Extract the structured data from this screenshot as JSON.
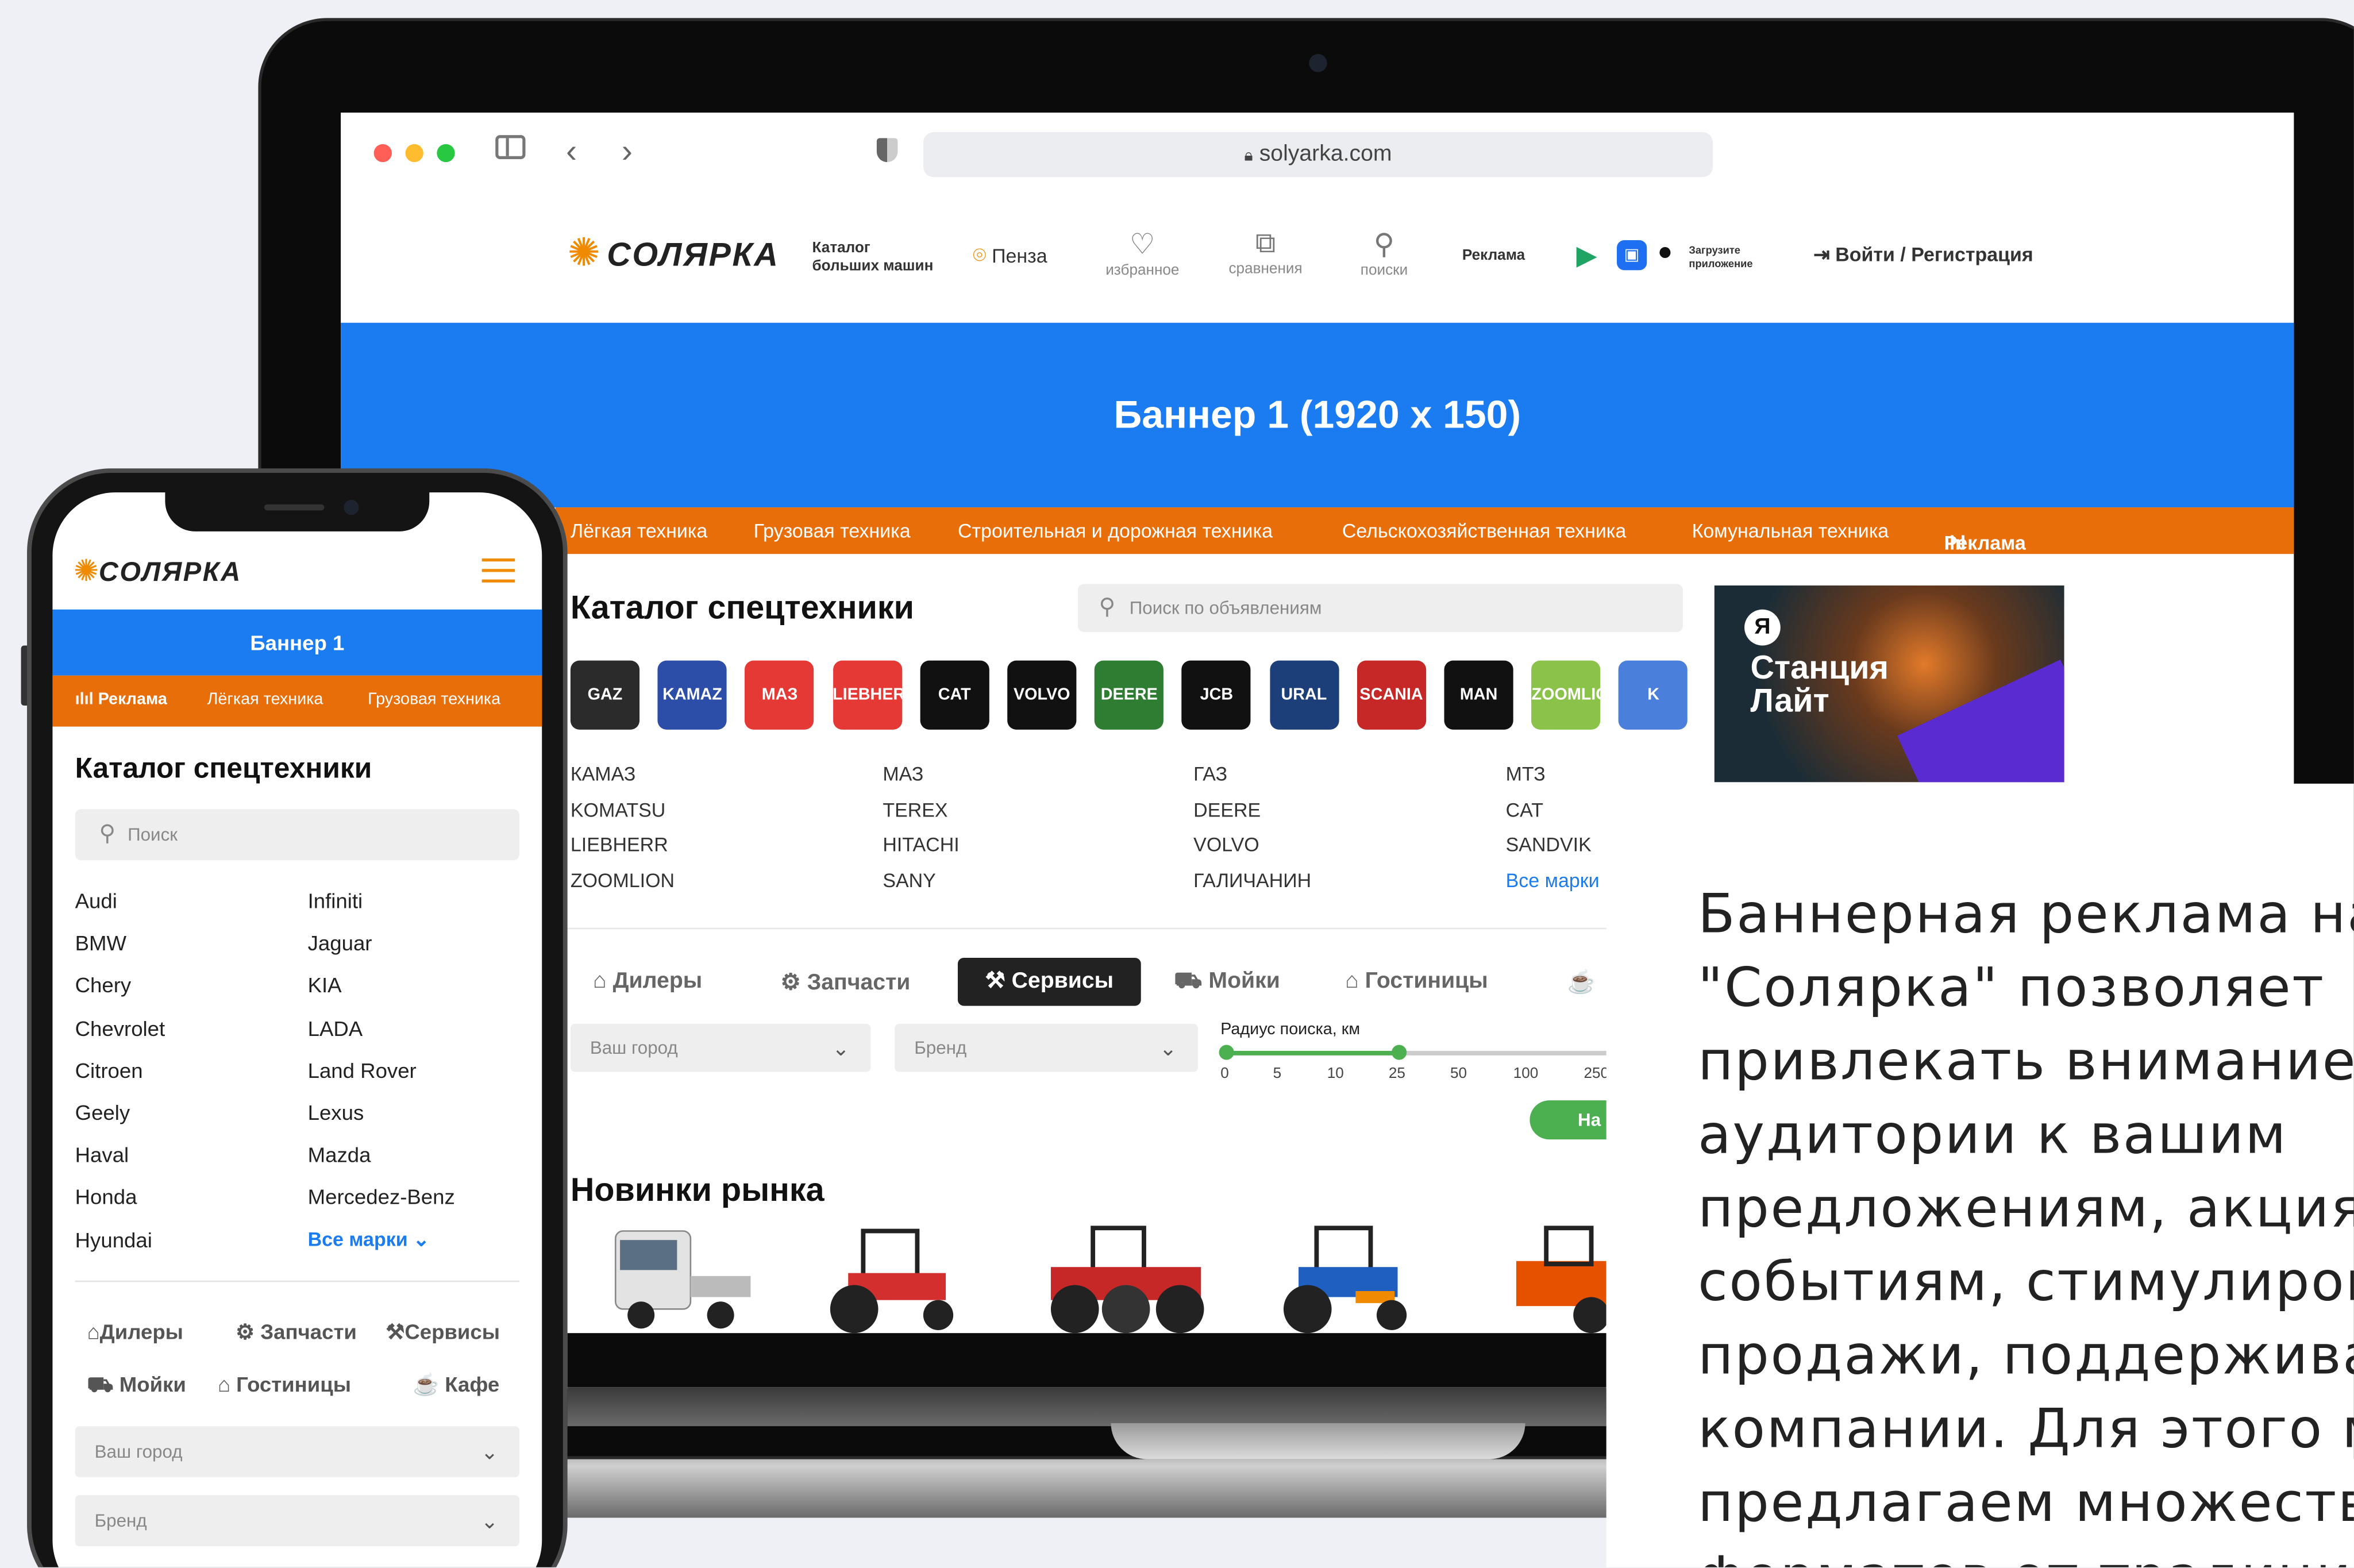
{
  "browser": {
    "url": "solyarka.com"
  },
  "site": {
    "logo": "СОЛЯРКА",
    "tagline_1": "Каталог",
    "tagline_2": "больших машин",
    "city": "Пенза",
    "nav": [
      "избранное",
      "сравнения",
      "поиски"
    ],
    "ads_link": "Реклама",
    "app_1": "Загрузите",
    "app_2": "приложение",
    "login": "Войти / Регистрация"
  },
  "banner": {
    "text": "Баннер 1 (1920 х 150)"
  },
  "categories": [
    "Лёгкая техника",
    "Грузовая техника",
    "Строительная и дорожная техника",
    "Сельскохозяйственная техника",
    "Комунальная техника",
    "Реклама"
  ],
  "catalog": {
    "title": "Каталог спецтехники",
    "search_placeholder": "Поиск по объявлениям",
    "logos": [
      {
        "label": "GAZ",
        "color": "#2b2b2b"
      },
      {
        "label": "KAMAZ",
        "color": "#2d4ea8"
      },
      {
        "label": "МАЗ",
        "color": "#e53935"
      },
      {
        "label": "LIEBHERR",
        "color": "#e53935"
      },
      {
        "label": "CAT",
        "color": "#111111"
      },
      {
        "label": "VOLVO",
        "color": "#111111"
      },
      {
        "label": "DEERE",
        "color": "#2e7d32"
      },
      {
        "label": "JCB",
        "color": "#111111"
      },
      {
        "label": "URAL",
        "color": "#1c3f7a"
      },
      {
        "label": "SCANIA",
        "color": "#c62828"
      },
      {
        "label": "MAN",
        "color": "#111111"
      },
      {
        "label": "ZOOMLION",
        "color": "#8bc34a"
      },
      {
        "label": "K",
        "color": "#4a7fdc"
      }
    ],
    "brands": [
      [
        "КАМАЗ",
        "KOMATSU",
        "LIEBHERR",
        "ZOOMLION"
      ],
      [
        "МАЗ",
        "TEREX",
        "HITACHI",
        "SANY"
      ],
      [
        "ГАЗ",
        "DEERE",
        "VOLVO",
        "ГАЛИЧАНИН"
      ],
      [
        "МТЗ",
        "CAT",
        "SANDVIK",
        "Все марки"
      ]
    ]
  },
  "tabs": [
    "Дилеры",
    "Запчасти",
    "Сервисы",
    "Мойки",
    "Гостиницы"
  ],
  "filters": {
    "city": "Ваш город",
    "brand": "Бренд",
    "radius_label": "Радиус поиска, км",
    "ticks": [
      "0",
      "5",
      "10",
      "25",
      "50",
      "100",
      "250"
    ],
    "button": "На"
  },
  "ad": {
    "line1": "Станция",
    "line2": "Лайт",
    "mark": "Я"
  },
  "news": {
    "title": "Новинки рынка"
  },
  "description": {
    "lines": [
      "Баннерная реклама на п",
      "\"Солярка\" позволяет",
      "привлекать внимание це",
      "аудитории к вашим",
      "предложениям, акциям,",
      "событиям, стимулирова",
      "продажи, поддерживать",
      "компании. Для этого мы",
      "предлагаем множество",
      "форматов от традицион"
    ]
  },
  "mobile": {
    "logo": "СОЛЯРКА",
    "banner": "Баннер 1",
    "nav": [
      "Реклама",
      "Лёгкая техника",
      "Грузовая техника"
    ],
    "title": "Каталог спецтехники",
    "search": "Поиск",
    "brands_left": [
      "Audi",
      "BMW",
      "Chery",
      "Chevrolet",
      "Citroen",
      "Geely",
      "Haval",
      "Honda",
      "Hyundai"
    ],
    "brands_right": [
      "Infiniti",
      "Jaguar",
      "KIA",
      "LADA",
      "Land Rover",
      "Lexus",
      "Mazda",
      "Mercedez-Benz"
    ],
    "all_brands": "Все марки",
    "tabs_row1": [
      "Дилеры",
      "Запчасти",
      "Сервисы"
    ],
    "tabs_row2": [
      "Мойки",
      "Гостиницы",
      "Кафе"
    ],
    "city": "Ваш город",
    "brand": "Бренд"
  },
  "colors": {
    "blue": "#1a7cf0",
    "orange": "#e86e0a",
    "green": "#4caf50"
  }
}
